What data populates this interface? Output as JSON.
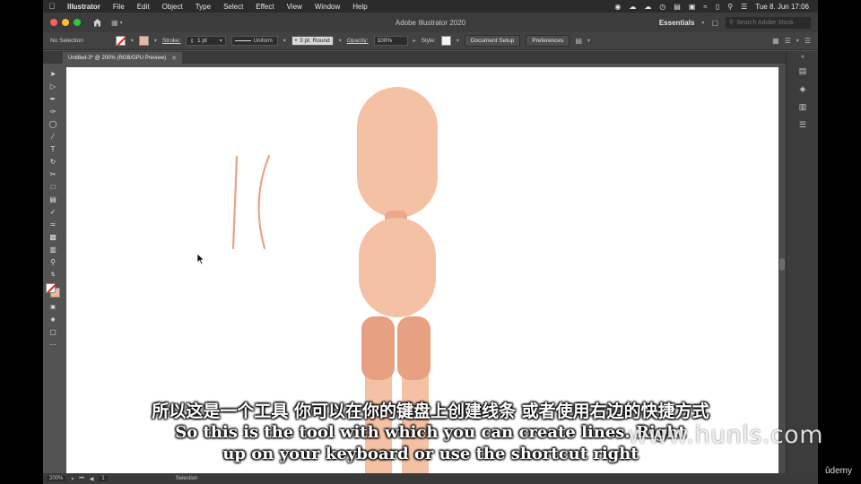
{
  "menubar": {
    "app_name": "Illustrator",
    "items": [
      "File",
      "Edit",
      "Object",
      "Type",
      "Select",
      "Effect",
      "View",
      "Window",
      "Help"
    ],
    "clock": "Tue 8. Jun  17:06"
  },
  "titlebar": {
    "title": "Adobe Illustrator 2020",
    "workspace": "Essentials",
    "search_placeholder": "Search Adobe Stock"
  },
  "controlbar": {
    "selection_label": "No Selection",
    "stroke_label": "Stroke:",
    "stroke_weight": "1 pt",
    "profile": "Uniform",
    "brush": "3 pt. Round",
    "opacity_label": "Opacity:",
    "opacity_value": "100%",
    "style_label": "Style:",
    "document_setup": "Document Setup",
    "preferences": "Preferences",
    "fill_color": "#f0b69a"
  },
  "document": {
    "tab_title": "Untitled-3* @ 200% (RGB/GPU Preview)"
  },
  "statusbar": {
    "zoom": "200%",
    "artboard": "1",
    "mode": "Selection"
  },
  "character": {
    "skin_color": "#f5c1a4",
    "neck_color": "#eba98c",
    "shorts_color": "#e8a083"
  },
  "subtitles": {
    "chinese": "所以这是一个工具 你可以在你的键盘上创建线条 或者使用右边的快捷方式",
    "english_line1": "So this is the tool with which you can create lines. Right",
    "english_line2": "up on your keyboard or use the shortcut right"
  },
  "watermark": "www.hunls.com",
  "udemy": "ûdemy"
}
